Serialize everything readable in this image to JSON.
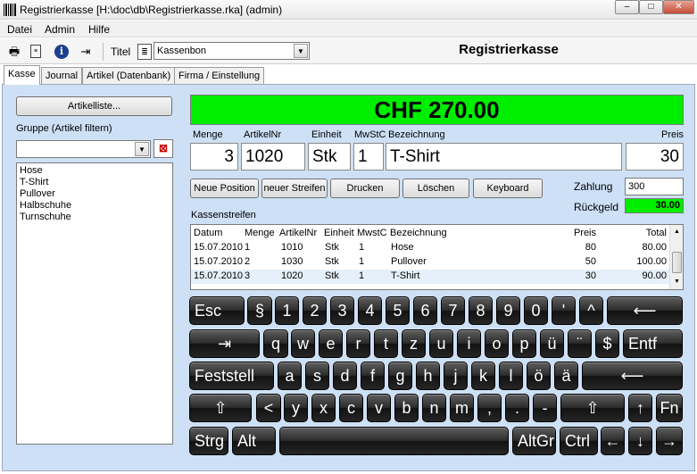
{
  "window": {
    "title": "Registrierkasse [H:\\doc\\db\\Registrierkasse.rka] (admin)",
    "min": "–",
    "max": "□",
    "close": "✕"
  },
  "menu": [
    "Datei",
    "Admin",
    "Hilfe"
  ],
  "toolbar": {
    "titel_label": "Titel",
    "titel_value": "Kassenbon",
    "heading": "Registrierkasse"
  },
  "tabs": [
    "Kasse",
    "Journal",
    "Artikel (Datenbank)",
    "Firma / Einstellung"
  ],
  "left": {
    "artikelliste": "Artikelliste...",
    "gruppe_label": "Gruppe (Artikel filtern)",
    "gruppe_value": "",
    "items": [
      "Hose",
      "T-Shirt",
      "Pullover",
      "Halbschuhe",
      "Turnschuhe"
    ]
  },
  "total": "CHF 270.00",
  "fields": {
    "menge_label": "Menge",
    "menge": "3",
    "artikelnr_label": "ArtikelNr",
    "artikelnr": "1020",
    "einheit_label": "Einheit",
    "einheit": "Stk",
    "mwst_label": "MwStC",
    "mwst": "1",
    "bezeichnung_label": "Bezeichnung",
    "bezeichnung": "T-Shirt",
    "preis_label": "Preis",
    "preis": "30"
  },
  "actions": [
    "Neue Position",
    "neuer Streifen",
    "Drucken",
    "Löschen",
    "Keyboard"
  ],
  "payment": {
    "zahlung_label": "Zahlung",
    "zahlung": "300",
    "rueckgeld_label": "Rückgeld",
    "rueckgeld": "30.00"
  },
  "kassenstreifen": {
    "label": "Kassenstreifen",
    "headers": [
      "Datum",
      "Menge",
      "ArtikelNr",
      "Einheit",
      "MwstC",
      "Bezeichnung",
      "Preis",
      "Total"
    ],
    "rows": [
      [
        "15.07.2010",
        "1",
        "1010",
        "Stk",
        "1",
        "Hose",
        "80",
        "80.00"
      ],
      [
        "15.07.2010",
        "2",
        "1030",
        "Stk",
        "1",
        "Pullover",
        "50",
        "100.00"
      ],
      [
        "15.07.2010",
        "3",
        "1020",
        "Stk",
        "1",
        "T-Shirt",
        "30",
        "90.00"
      ]
    ]
  },
  "keyboard": {
    "row1": [
      "Esc",
      "§",
      "1",
      "2",
      "3",
      "4",
      "5",
      "6",
      "7",
      "8",
      "9",
      "0",
      "'",
      "^",
      "⟵"
    ],
    "row2": [
      "⇥",
      "q",
      "w",
      "e",
      "r",
      "t",
      "z",
      "u",
      "i",
      "o",
      "p",
      "ü",
      "¨",
      "$",
      "Entf"
    ],
    "row3": [
      "Feststell",
      "a",
      "s",
      "d",
      "f",
      "g",
      "h",
      "j",
      "k",
      "l",
      "ö",
      "ä",
      "⟵"
    ],
    "row4": [
      "⇧",
      "<",
      "y",
      "x",
      "c",
      "v",
      "b",
      "n",
      "m",
      ",",
      ".",
      "-",
      "⇧",
      "↑",
      "Fn"
    ],
    "row5": [
      "Strg",
      "Alt",
      "",
      "AltGr",
      "Ctrl",
      "←",
      "↓",
      "→"
    ]
  }
}
